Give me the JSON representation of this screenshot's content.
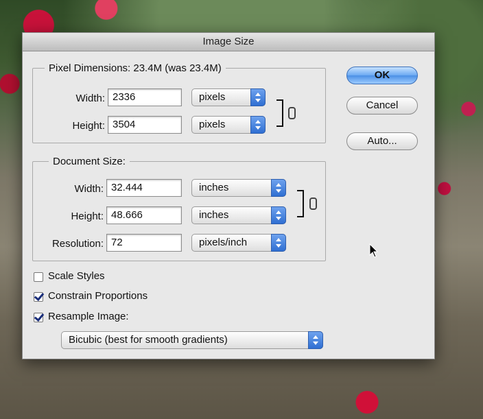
{
  "dialog": {
    "title": "Image Size",
    "buttons": {
      "ok": "OK",
      "cancel": "Cancel",
      "auto": "Auto..."
    },
    "pixel_dimensions": {
      "legend": "Pixel Dimensions:  23.4M (was 23.4M)",
      "width_label": "Width:",
      "width_value": "2336",
      "width_unit": "pixels",
      "height_label": "Height:",
      "height_value": "3504",
      "height_unit": "pixels"
    },
    "document_size": {
      "legend": "Document Size:",
      "width_label": "Width:",
      "width_value": "32.444",
      "width_unit": "inches",
      "height_label": "Height:",
      "height_value": "48.666",
      "height_unit": "inches",
      "resolution_label": "Resolution:",
      "resolution_value": "72",
      "resolution_unit": "pixels/inch"
    },
    "options": {
      "scale_styles": {
        "label": "Scale Styles",
        "checked": false
      },
      "constrain_proportions": {
        "label": "Constrain Proportions",
        "checked": true
      },
      "resample_image": {
        "label": "Resample Image:",
        "checked": true
      }
    },
    "resample_method": "Bicubic (best for smooth gradients)"
  },
  "colors": {
    "accent": "#4c90e6",
    "dialog_bg": "#e8e8e8"
  }
}
